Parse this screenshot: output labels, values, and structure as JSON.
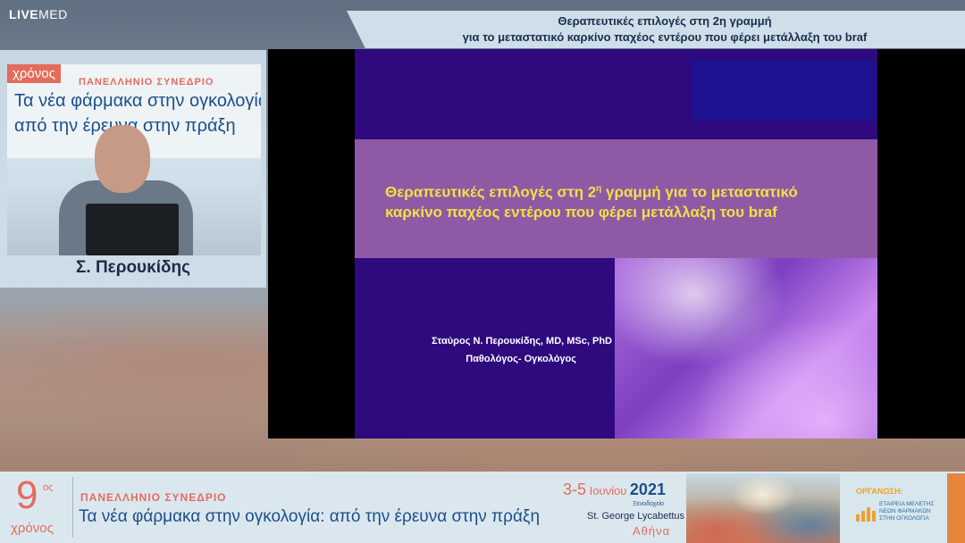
{
  "brand": {
    "live": "LIVE",
    "med": "MED"
  },
  "top_title": {
    "line1": "Θεραπευτικές επιλογές στη 2η γραμμή",
    "line2": "για το μεταστατικό καρκίνο παχέος εντέρου που φέρει μετάλλαξη του braf"
  },
  "speaker_video": {
    "chronos": "χρόνος",
    "congress": "ΠΑΝΕΛΛΗΝΙΟ ΣΥΝΕΔΡΙΟ",
    "line1": "Τα νέα φάρμακα στην ογκολογία",
    "line2": "από την έρευνα στην πράξη"
  },
  "speaker": {
    "name": "Σ. Περουκίδης"
  },
  "slide": {
    "title_part1": "Θεραπευτικές επιλογές στη 2",
    "title_sup": "η",
    "title_part2": " γραμμή για το μεταστατικό καρκίνο παχέος εντέρου που φέρει μετάλλαξη του braf",
    "author": "Σταύρος Ν. Περουκίδης, MD, MSc, PhD",
    "role": "Παθολόγος- Ογκολόγος"
  },
  "banner": {
    "edition_number": "9",
    "edition_suffix": "ος",
    "chronos": "χρόνος",
    "congress": "ΠΑΝΕΛΛΗΝΙΟ ΣΥΝΕΔΡΙΟ",
    "tagline_main": "Τα νέα φάρμακα στην ογκολογία:",
    "tagline_rest": " από την έρευνα στην πράξη",
    "dates": "3-5",
    "month": " Ιουνίου ",
    "year": "2021",
    "hotel_label": "Ξενοδοχείο",
    "hotel": "St. George Lycabettus",
    "city": "Αθήνα",
    "org_label": "ΟΡΓΑΝΩΣΗ:",
    "org_name": "ΕΤΑΙΡΕΙΑ ΜΕΛΕΤΗΣ ΝΕΩΝ ΦΑΡΜΑΚΩΝ ΣΤΗΝ ΟΓΚΟΛΟΓΙΑ"
  },
  "colors": {
    "accent": "#e36c5c",
    "brand_blue": "#1b4f8a",
    "slide_bg": "#2e0a7e",
    "slide_title": "#f5df45"
  }
}
